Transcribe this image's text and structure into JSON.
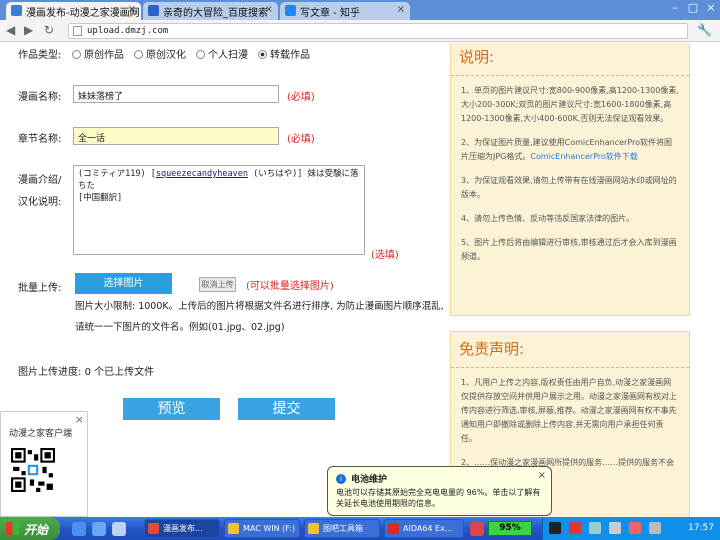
{
  "tabs": [
    {
      "title": "漫画发布-动漫之家漫画网",
      "active": true,
      "favicon_color": "#3d7bd8"
    },
    {
      "title": "亲奇的大冒险_百度搜索",
      "active": false,
      "favicon_color": "#2d62c9"
    },
    {
      "title": "写文章 - 知乎",
      "active": false,
      "favicon_color": "#1f86f2"
    }
  ],
  "address": {
    "url": "upload.dmzj.com"
  },
  "form": {
    "type_label": "作品类型:",
    "type_options": [
      "原创作品",
      "原创汉化",
      "个人扫漫",
      "转载作品"
    ],
    "type_selected": 3,
    "title_label": "漫画名称:",
    "title_value": "妹妹落榜了",
    "chapter_label": "章节名称:",
    "chapter_value": "全一话",
    "required_text": "(必填)",
    "intro_label_1": "漫画介绍/",
    "intro_label_2": "汉化说明:",
    "intro_line1_pre": "(コミティア119) [",
    "intro_link": "squeezecandyheaven",
    "intro_line1_post": " (いちはや)] 妹は受験に落ちた",
    "intro_line2": "[中国翻訳]",
    "optional_text": "(选填)",
    "batch_label": "批量上传:",
    "select_button": "选择图片",
    "cancel_button": "取消上传",
    "batch_hint": "(可以批量选择图片)",
    "note": "图片大小限制: 1000K。上传后的图片将根据文件名进行排序, 为防止漫画图片顺序混乱, 请统一一下图片的文件名。例如(01.jpg、02.jpg)",
    "progress_label": "图片上传进度:",
    "progress_value": "0 个已上传文件",
    "preview_button": "预览",
    "submit_button": "提交"
  },
  "instructions": {
    "title": "说明:",
    "items": [
      "1、单页的图片建议尺寸:宽800-900像素,高1200-1300像素,大小200-300K;双页的图片建议尺寸:宽1600-1800像素,高1200-1300像素,大小400-600K,否则无法保证观看效果。",
      "2、为保证图片质量,建议使用ComicEnhancerPro软件将图片压缩为JPG格式。",
      "3、为保证观看效果,请勿上传带有在线漫画网站水印或网址的版本。",
      "4、请勿上传色情、反动等违反国家法律的图片。",
      "5、图片上传后将由编辑进行审核,审核通过后才会入库到漫画频道。"
    ],
    "download_link": "ComicEnhancerPro软件下载"
  },
  "disclaimer": {
    "title": "免责声明:",
    "items": [
      "1、凡用户上传之内容,版权责任由用户自负,动漫之家漫画网仅提供存放空间并供用户展示之用。动漫之家漫画网有权对上传内容进行筛选,审核,屏蔽,推荐。动漫之家漫画网有权不事先通知用户即撤除或删除上传内容,并无需向用户承担任何责任。",
      "2、……保动漫之家漫画网所提供的服务……提供的服务不会被中……"
    ]
  },
  "widget": {
    "title": "动漫之家客户端"
  },
  "balloon": {
    "title": "电池维护",
    "message": "电池可以存储其原始完全充电电量的 96%。单击以了解有关延长电池使用期限的信息。"
  },
  "taskbar": {
    "start_label": "开始",
    "buttons": [
      "漫画发布...",
      "MAC WIN (F:)",
      "图吧工具箱",
      "AIDA64 Ex..."
    ],
    "battery": "95%",
    "clock": "17:57"
  }
}
